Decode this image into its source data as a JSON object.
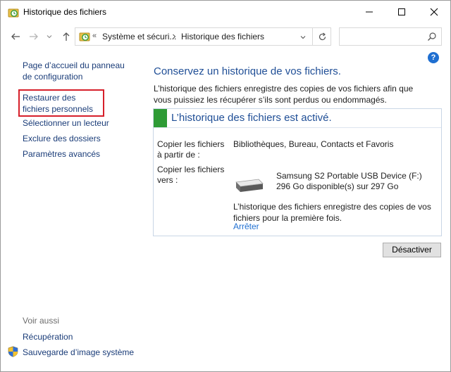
{
  "window": {
    "title": "Historique des fichiers"
  },
  "address_bar": {
    "overflow": "«",
    "crumb_1": "Système et sécuri...",
    "crumb_2": "Historique des fichiers"
  },
  "search": {
    "placeholder": ""
  },
  "help": {
    "label": "?"
  },
  "sidebar": {
    "home_link": "Page d’accueil du panneau de configuration",
    "restore_link": "Restaurer des fichiers personnels",
    "select_drive_link": "Sélectionner un lecteur",
    "exclude_link": "Exclure des dossiers",
    "advanced_link": "Paramètres avancés",
    "see_also": "Voir aussi",
    "recovery_link": "Récupération",
    "system_image_link": "Sauvegarde d’image système"
  },
  "main": {
    "title": "Conservez un historique de vos fichiers.",
    "description": "L’historique des fichiers enregistre des copies de vos fichiers afin que vous puissiez les récupérer s’ils sont perdus ou endommagés.",
    "status": "L’historique des fichiers est activé.",
    "copy_from_label": "Copier les fichiers à partir de :",
    "copy_from_value": "Bibliothèques, Bureau, Contacts et Favoris",
    "copy_to_label": "Copier les fichiers vers :",
    "drive_name": "Samsung S2 Portable USB Device (F:)",
    "drive_space": "296 Go disponible(s) sur 297 Go",
    "info": "L’historique des fichiers enregistre des copies de vos fichiers pour la première fois.",
    "stop_link": "Arrêter",
    "disable_button": "Désactiver"
  },
  "colors": {
    "accent_title": "#1f4e96",
    "status_green": "#2e9b35",
    "highlight_box": "#d61f2a",
    "link": "#1f6fd1"
  }
}
